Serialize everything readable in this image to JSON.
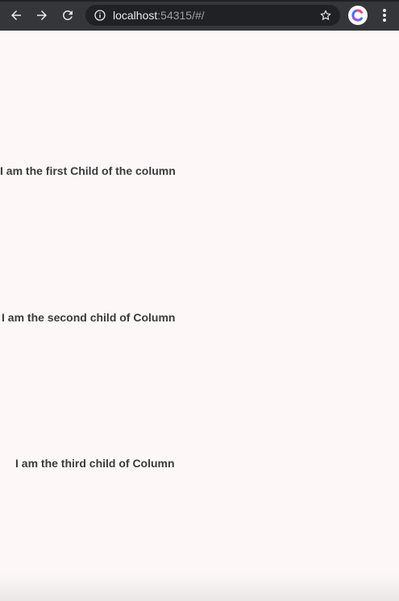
{
  "browser": {
    "url_host": "localhost",
    "url_rest": ":54315/#/",
    "icons": [
      "back-arrow-icon",
      "forward-arrow-icon",
      "reload-icon",
      "info-icon",
      "star-icon",
      "profile-avatar",
      "more-vert-icon"
    ],
    "colors": {
      "toolbar": "#35363a",
      "omnibox": "#202124",
      "text": "#e8eaed",
      "muted": "#9aa0a6"
    }
  },
  "page": {
    "background": "#fdf8f7",
    "children": [
      {
        "text": "I am the first Child of the column"
      },
      {
        "text": "I am the second child of Column"
      },
      {
        "text": "I am the third child of Column"
      }
    ]
  }
}
